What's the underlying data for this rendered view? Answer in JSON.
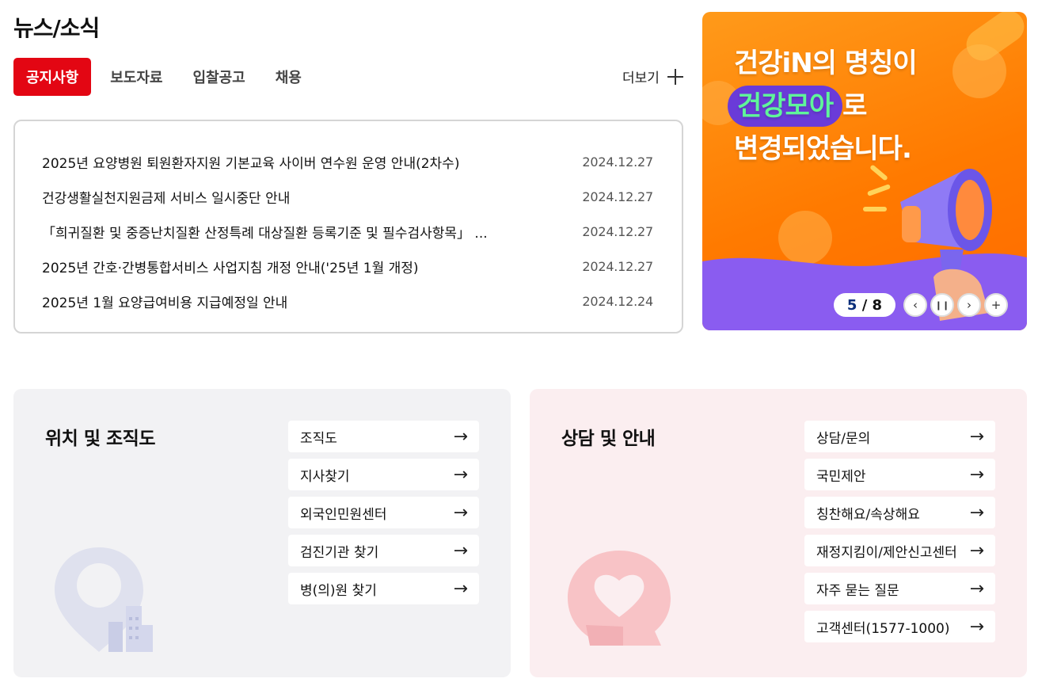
{
  "news": {
    "title": "뉴스/소식",
    "tabs": [
      {
        "label": "공지사항"
      },
      {
        "label": "보도자료"
      },
      {
        "label": "입찰공고"
      },
      {
        "label": "채용"
      }
    ],
    "more_label": "더보기",
    "items": [
      {
        "title": "2025년 요양병원 퇴원환자지원 기본교육 사이버 연수원 운영 안내(2차수)",
        "date": "2024.12.27"
      },
      {
        "title": "건강생활실천지원금제 서비스 일시중단 안내",
        "date": "2024.12.27"
      },
      {
        "title": "「희귀질환 및 중증난치질환 산정특례 대상질환 등록기준 및 필수검사항목」 ...",
        "date": "2024.12.27"
      },
      {
        "title": "2025년 간호·간병통합서비스 사업지침 개정 안내('25년 1월 개정)",
        "date": "2024.12.27"
      },
      {
        "title": "2025년 1월 요양급여비용 지급예정일 안내",
        "date": "2024.12.24"
      }
    ]
  },
  "banner": {
    "line1": "건강iN의 명칭이",
    "pill": "건강모아",
    "line2_suffix": "로",
    "line3": "변경되었습니다.",
    "current": "5",
    "separator": " / ",
    "total": "8",
    "colors": {
      "bg": "#ff7a00",
      "wave": "#8a5cf0",
      "pill_bg": "#6a3bd8",
      "pill_text": "#5ff59a"
    }
  },
  "location": {
    "title": "위치 및 조직도",
    "links": [
      {
        "label": "조직도"
      },
      {
        "label": "지사찾기"
      },
      {
        "label": "외국인민원센터"
      },
      {
        "label": "검진기관 찾기"
      },
      {
        "label": "병(의)원 찾기"
      }
    ],
    "icon": "map-pin-building-icon"
  },
  "consult": {
    "title": "상담 및 안내",
    "links": [
      {
        "label": "상담/문의"
      },
      {
        "label": "국민제안"
      },
      {
        "label": "칭찬해요/속상해요"
      },
      {
        "label": "재정지킴이/제안신고센터"
      },
      {
        "label": "자주 묻는 질문"
      },
      {
        "label": "고객센터(1577-1000)"
      }
    ],
    "icon": "heart-speech-bubble-icon"
  },
  "colors": {
    "accent": "#e30613",
    "card_gray": "#f2f2f4",
    "card_pink": "#fbeef0"
  }
}
